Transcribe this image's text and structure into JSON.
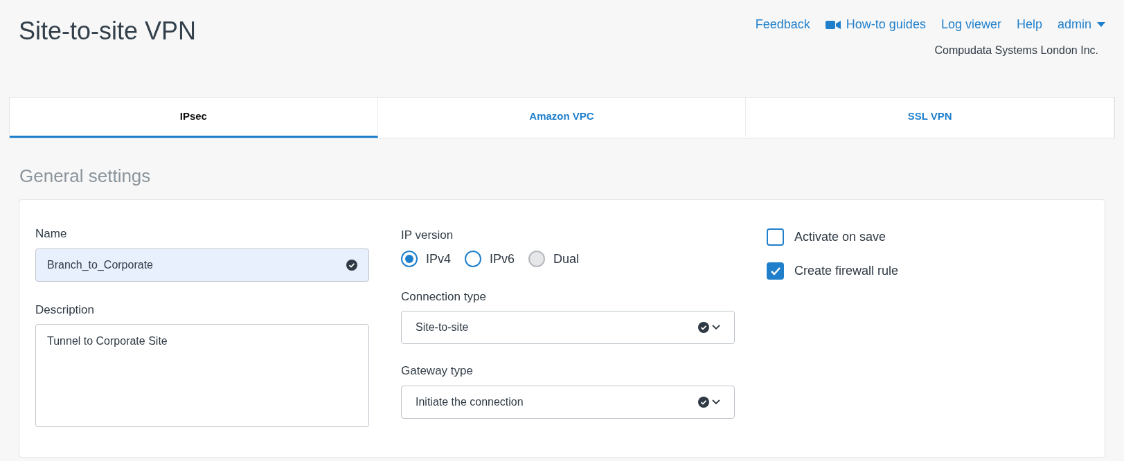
{
  "header": {
    "title": "Site-to-site VPN",
    "links": [
      {
        "label": "Feedback",
        "kind": "text"
      },
      {
        "label": "How-to guides",
        "kind": "video"
      },
      {
        "label": "Log viewer",
        "kind": "text"
      },
      {
        "label": "Help",
        "kind": "text"
      },
      {
        "label": "admin",
        "kind": "menu"
      }
    ],
    "organization": "Compudata Systems London Inc."
  },
  "tabs": [
    {
      "label": "IPsec",
      "selected": true
    },
    {
      "label": "Amazon VPC",
      "selected": false
    },
    {
      "label": "SSL VPN",
      "selected": false
    }
  ],
  "section_title": "General settings",
  "form": {
    "name": {
      "label": "Name",
      "value": "Branch_to_Corporate"
    },
    "description": {
      "label": "Description",
      "value": "Tunnel to Corporate Site"
    },
    "ip_version": {
      "label": "IP version",
      "options": [
        {
          "label": "IPv4",
          "selected": true,
          "disabled": false
        },
        {
          "label": "IPv6",
          "selected": false,
          "disabled": false
        },
        {
          "label": "Dual",
          "selected": false,
          "disabled": true
        }
      ]
    },
    "connection_type": {
      "label": "Connection type",
      "value": "Site-to-site"
    },
    "gateway_type": {
      "label": "Gateway type",
      "value": "Initiate the connection"
    },
    "checkboxes": [
      {
        "label": "Activate on save",
        "checked": false
      },
      {
        "label": "Create firewall rule",
        "checked": true
      }
    ]
  }
}
